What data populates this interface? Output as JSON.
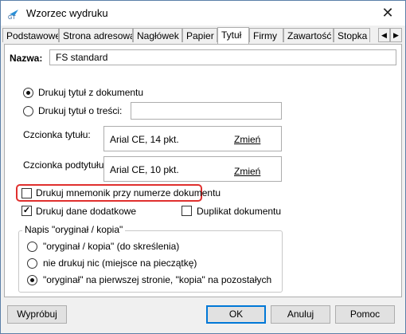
{
  "window": {
    "title": "Wzorzec wydruku"
  },
  "tabs": [
    {
      "label": "Podstawowe"
    },
    {
      "label": "Strona adresowa"
    },
    {
      "label": "Nagłówek"
    },
    {
      "label": "Papier"
    },
    {
      "label": "Tytuł",
      "active": true
    },
    {
      "label": "Firmy"
    },
    {
      "label": "Zawartość"
    },
    {
      "label": "Stopka"
    }
  ],
  "name_field": {
    "label": "Nazwa:",
    "value": "FS standard"
  },
  "title_source": {
    "options": [
      {
        "label": "Drukuj tytuł z dokumentu",
        "selected": true
      },
      {
        "label": "Drukuj tytuł o treści:",
        "selected": false
      }
    ],
    "custom_title_value": ""
  },
  "fonts": {
    "title_label": "Czcionka tytułu:",
    "title_font": "Arial CE, 14 pkt.",
    "subtitle_label": "Czcionka podtytułu:",
    "subtitle_font": "Arial CE, 10 pkt.",
    "change_link": "Zmień"
  },
  "checkboxes": {
    "mnemonic": {
      "label": "Drukuj mnemonik przy numerze dokumentu",
      "checked": false
    },
    "extra_data": {
      "label": "Drukuj dane dodatkowe",
      "checked": true
    },
    "duplicate": {
      "label": "Duplikat dokumentu",
      "checked": false
    }
  },
  "original_copy_group": {
    "legend": "Napis \"oryginał / kopia\"",
    "options": [
      {
        "label": "\"oryginał / kopia\" (do skreślenia)",
        "selected": false
      },
      {
        "label": "nie drukuj nic (miejsce na pieczątkę)",
        "selected": false
      },
      {
        "label": "\"oryginał\" na pierwszej stronie, \"kopia\" na pozostałych",
        "selected": true
      }
    ]
  },
  "buttons": {
    "preview": "Wypróbuj",
    "ok": "OK",
    "cancel": "Anuluj",
    "help": "Pomoc"
  },
  "colors": {
    "highlight": "#e0302e",
    "accent": "#0078d7"
  }
}
